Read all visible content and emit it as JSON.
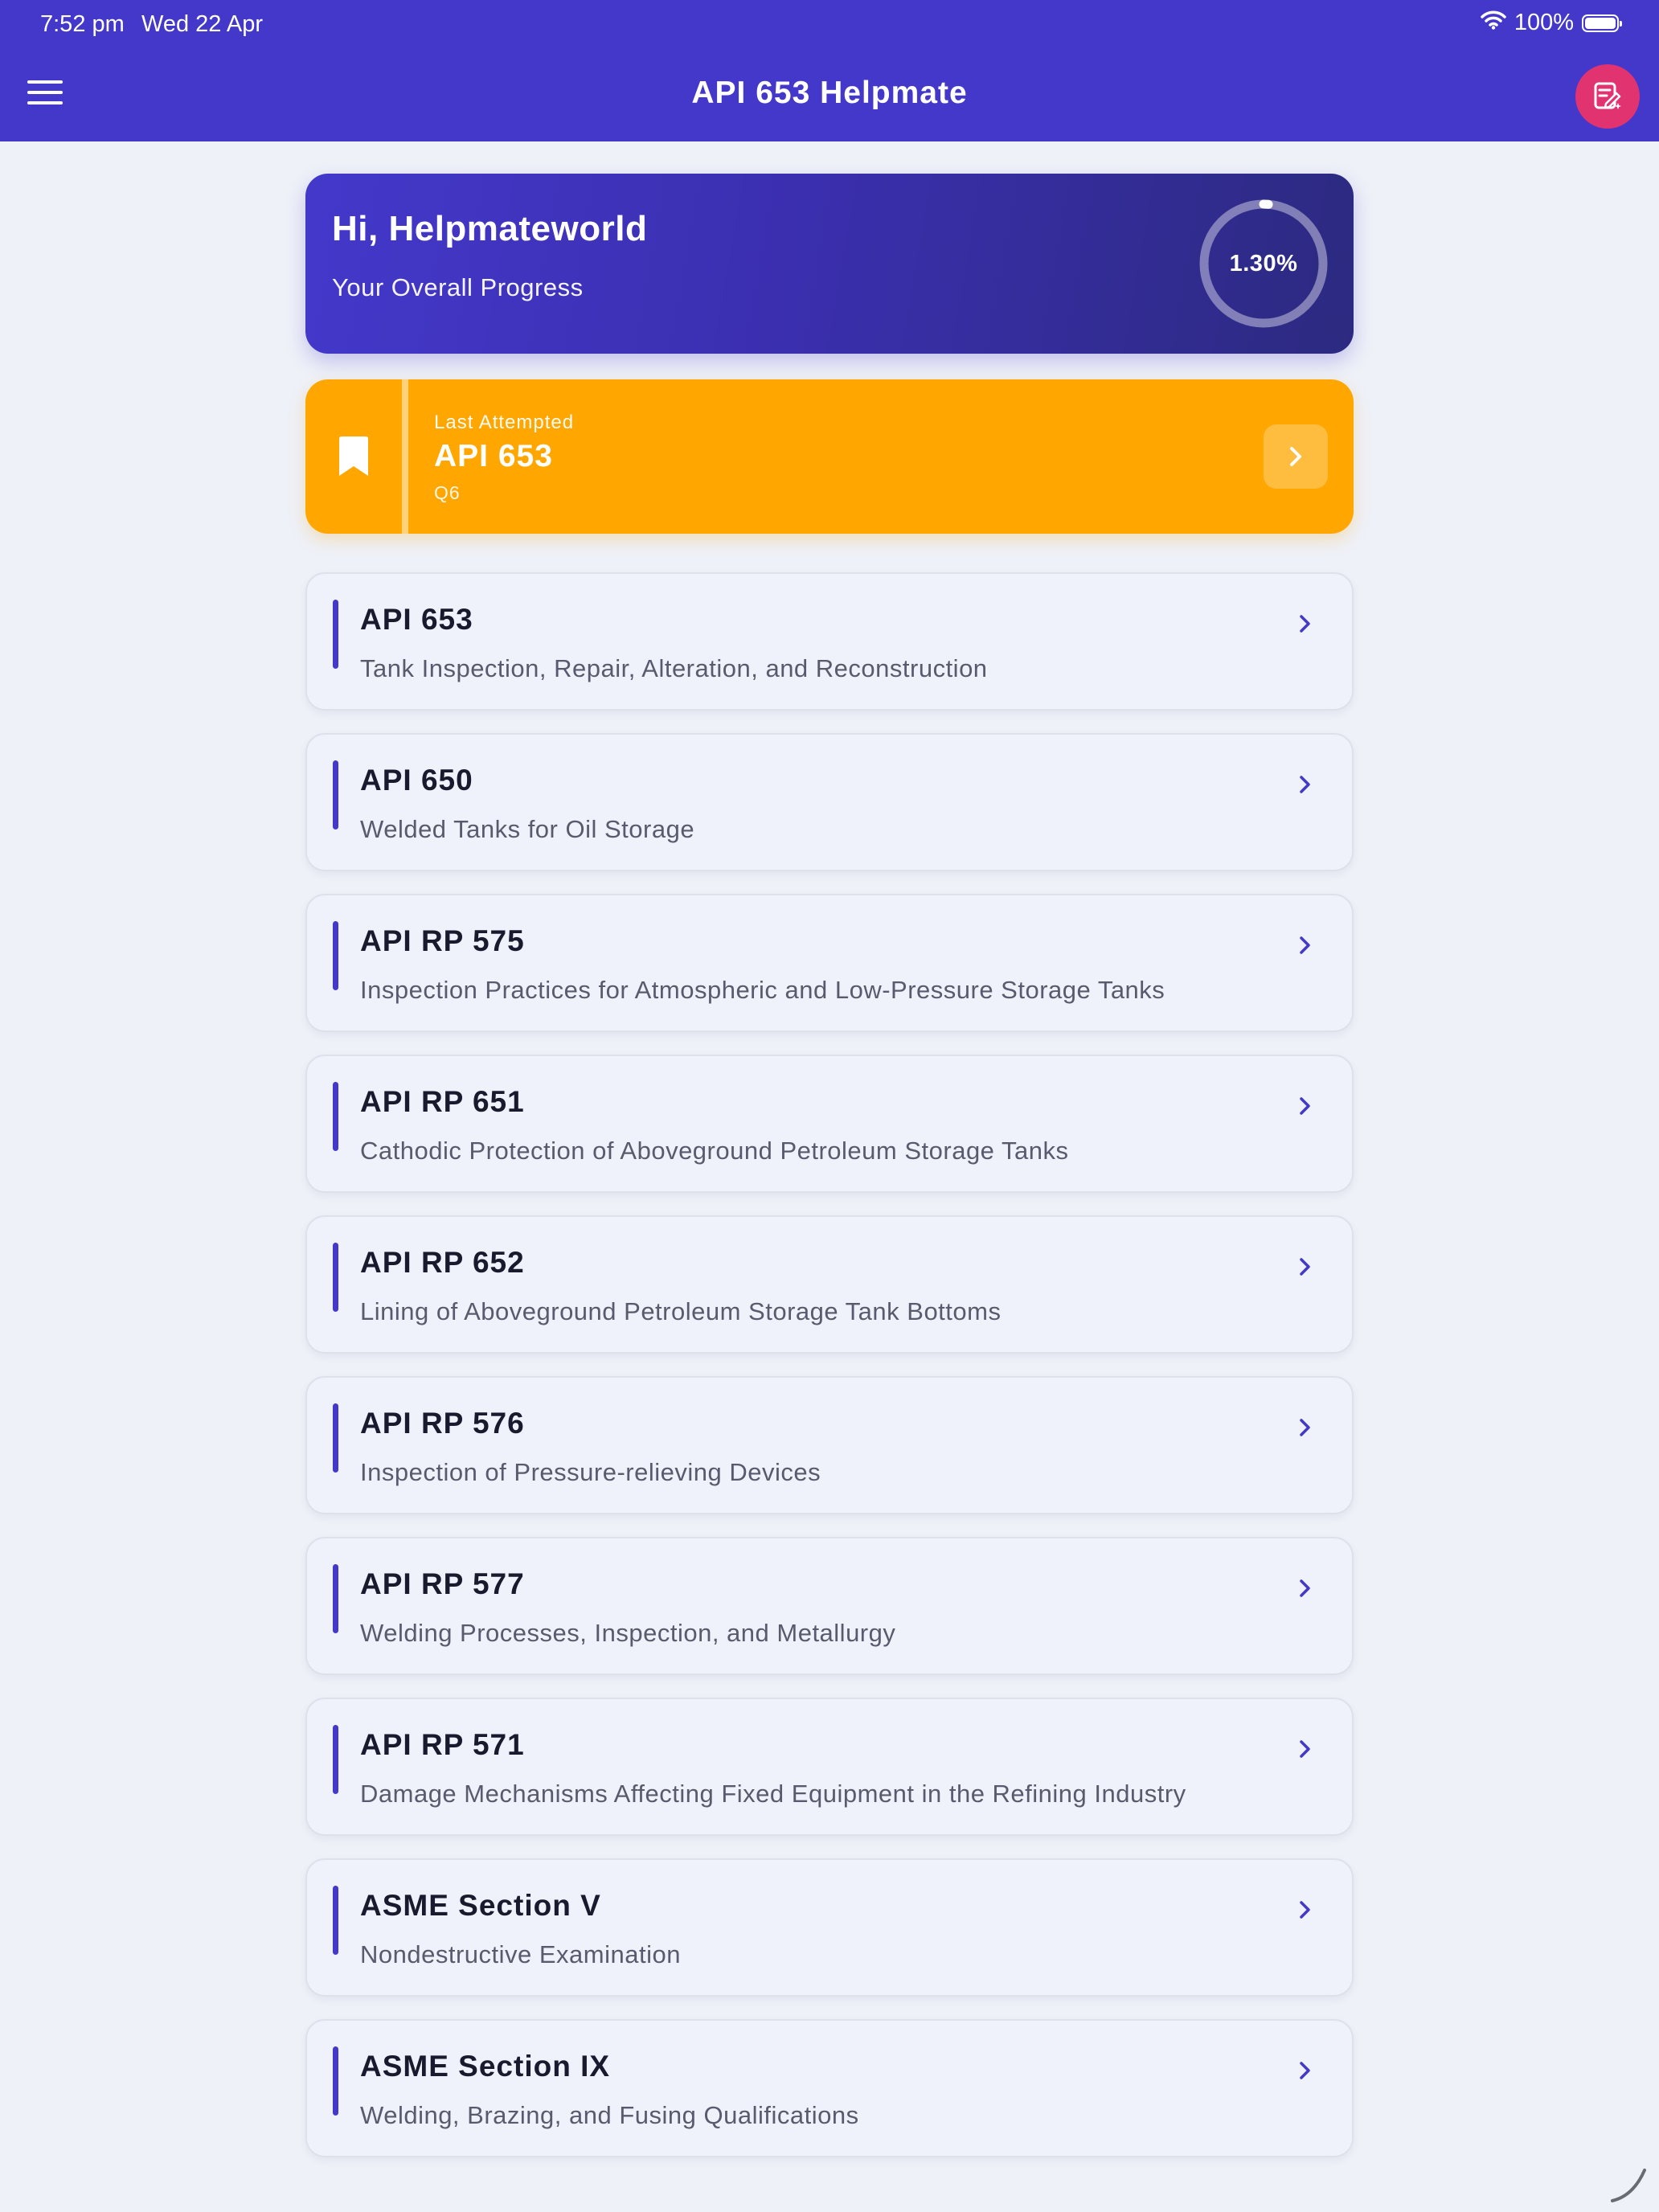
{
  "status_bar": {
    "time": "7:52 pm",
    "date": "Wed 22 Apr",
    "battery": "100%",
    "icons": [
      "wifi-icon",
      "battery-icon"
    ]
  },
  "app_bar": {
    "title": "API 653 Helpmate",
    "menu_icon": "hamburger-menu-icon",
    "action_icon": "quiz-edit-icon",
    "accent_color": "#4438cb",
    "action_color": "#e0336f"
  },
  "progress": {
    "greeting": "Hi, Helpmateworld",
    "subtitle": "Your Overall Progress",
    "percent_label": "1.30%",
    "percent_value": 1.3
  },
  "last_attempted": {
    "label": "Last Attempted",
    "title": "API 653",
    "question": "Q6",
    "icon": "bookmark-icon",
    "color": "#ffa700"
  },
  "courses": [
    {
      "title": "API 653",
      "subtitle": "Tank Inspection, Repair, Alteration, and Reconstruction"
    },
    {
      "title": "API 650",
      "subtitle": "Welded Tanks for Oil Storage"
    },
    {
      "title": "API RP 575",
      "subtitle": "Inspection Practices for Atmospheric and Low-Pressure Storage Tanks"
    },
    {
      "title": "API RP 651",
      "subtitle": "Cathodic Protection of Aboveground Petroleum Storage Tanks"
    },
    {
      "title": "API RP 652",
      "subtitle": "Lining of Aboveground Petroleum Storage Tank Bottoms"
    },
    {
      "title": "API RP 576",
      "subtitle": "Inspection of Pressure-relieving Devices"
    },
    {
      "title": "API RP 577",
      "subtitle": "Welding Processes, Inspection, and Metallurgy"
    },
    {
      "title": "API RP 571",
      "subtitle": "Damage Mechanisms Affecting Fixed Equipment in the Refining Industry"
    },
    {
      "title": "ASME Section V",
      "subtitle": "Nondestructive Examination"
    },
    {
      "title": "ASME Section IX",
      "subtitle": "Welding, Brazing, and Fusing Qualifications"
    }
  ]
}
